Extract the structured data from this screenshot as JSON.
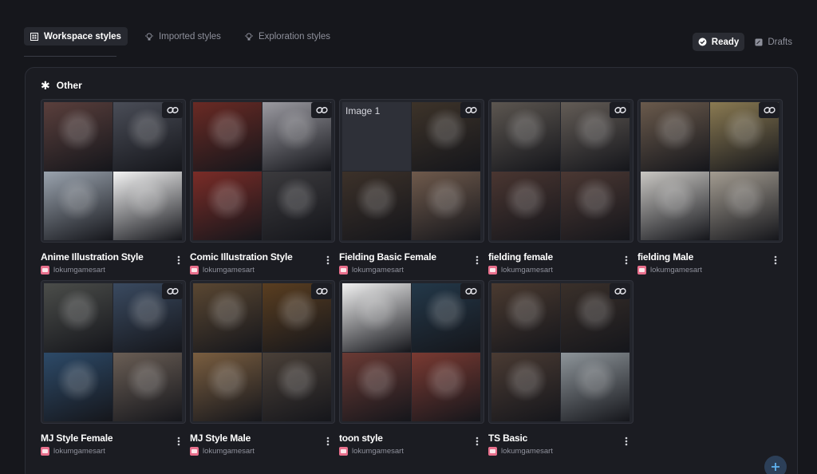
{
  "tabs": [
    {
      "label": "Workspace styles",
      "active": true,
      "icon": "grid-icon"
    },
    {
      "label": "Imported styles",
      "active": false,
      "icon": "lightbulb-icon"
    },
    {
      "label": "Exploration styles",
      "active": false,
      "icon": "lightbulb-icon"
    }
  ],
  "status": {
    "ready_label": "Ready",
    "drafts_label": "Drafts"
  },
  "group": {
    "title": "Other"
  },
  "broken_image_alt": "Image 1",
  "styles": [
    {
      "name": "Anime Illustration Style",
      "author": "lokumgamesart",
      "palette": [
        "#5a3f3c",
        "#4a4d57",
        "#9aa3ae",
        "#f4f4f4"
      ]
    },
    {
      "name": "Comic Illustration Style",
      "author": "lokumgamesart",
      "palette": [
        "#6a2a24",
        "#9b9aa1",
        "#7a2c27",
        "#3b3a3d"
      ]
    },
    {
      "name": "Fielding Basic Female",
      "author": "lokumgamesart",
      "palette": [
        "#2e3038",
        "#3d3329",
        "#3c3129",
        "#6f5a4c"
      ]
    },
    {
      "name": "fielding female",
      "author": "lokumgamesart",
      "palette": [
        "#5c5650",
        "#635c56",
        "#4a3631",
        "#4b3833"
      ]
    },
    {
      "name": "fielding Male",
      "author": "lokumgamesart",
      "palette": [
        "#6a5a4c",
        "#8a7a52",
        "#c9c7c3",
        "#a39c91"
      ]
    },
    {
      "name": "MJ Style Female",
      "author": "lokumgamesart",
      "palette": [
        "#4b4d4a",
        "#3a4a60",
        "#2d4a68",
        "#6a5e55"
      ]
    },
    {
      "name": "MJ Style Male",
      "author": "lokumgamesart",
      "palette": [
        "#5a4732",
        "#5a3e20",
        "#7a5e40",
        "#4a4038"
      ]
    },
    {
      "name": "toon style",
      "author": "lokumgamesart",
      "palette": [
        "#f2f2f2",
        "#233849",
        "#6a3a34",
        "#7a3a32"
      ]
    },
    {
      "name": "TS Basic",
      "author": "lokumgamesart",
      "palette": [
        "#4a3a30",
        "#3a302a",
        "#4a3b33",
        "#8e959a"
      ]
    }
  ]
}
